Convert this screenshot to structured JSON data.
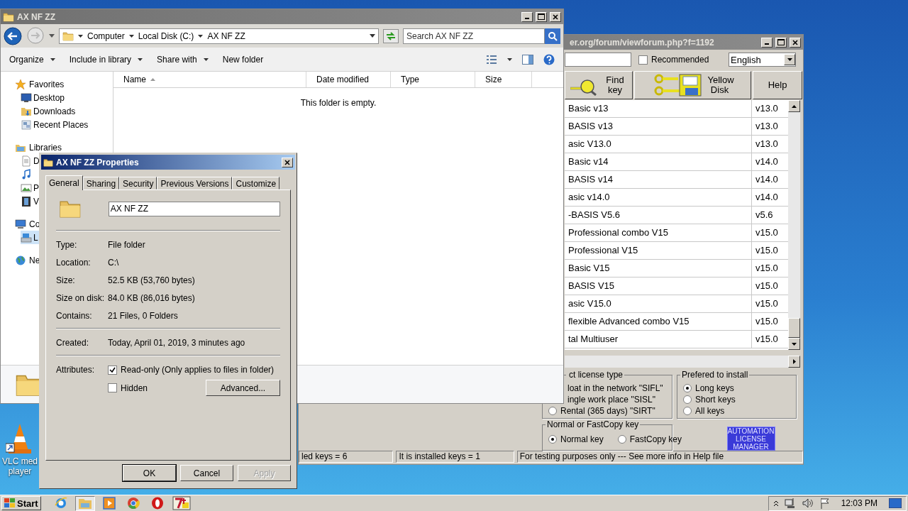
{
  "desktop": {
    "icons": [
      {
        "kind": "cone",
        "lines": [
          "VLC med",
          "player"
        ]
      }
    ]
  },
  "license_window": {
    "title": "er.org/forum/viewforum.php?f=1192",
    "recommended": {
      "label": "Recommended",
      "checked": false
    },
    "language": "English",
    "toolbar": [
      {
        "kind": "find",
        "label": "Find key"
      },
      {
        "kind": "disk",
        "label": "Yellow Disk"
      },
      {
        "kind": "text",
        "label": "Help"
      }
    ],
    "rows": [
      {
        "name": "Basic v13",
        "version": "v13.0"
      },
      {
        "name": "BASIS v13",
        "version": "v13.0"
      },
      {
        "name": "asic V13.0",
        "version": "v13.0"
      },
      {
        "name": "Basic v14",
        "version": "v14.0"
      },
      {
        "name": "BASIS v14",
        "version": "v14.0"
      },
      {
        "name": "asic v14.0",
        "version": "v14.0"
      },
      {
        "name": "-BASIS V5.6",
        "version": "v5.6"
      },
      {
        "name": "Professional combo V15",
        "version": "v15.0"
      },
      {
        "name": "Professional V15",
        "version": "v15.0"
      },
      {
        "name": "Basic V15",
        "version": "v15.0"
      },
      {
        "name": "BASIS V15",
        "version": "v15.0"
      },
      {
        "name": "asic V15.0",
        "version": "v15.0"
      },
      {
        "name": "flexible Advanced combo V15",
        "version": "v15.0"
      },
      {
        "name": "tal Multiuser",
        "version": "v15.0"
      }
    ],
    "license_type": {
      "title": "ct license type",
      "cut_options": [
        "loat in the network \"SIFL\"",
        "ingle work place \"SISL\""
      ],
      "rental": {
        "label": "Rental (365 days) \"SIRT\"",
        "selected": false
      }
    },
    "install": {
      "title": "Prefered to install",
      "options": [
        {
          "label": "Long keys",
          "selected": true
        },
        {
          "label": "Short keys",
          "selected": false
        },
        {
          "label": "All keys",
          "selected": false
        }
      ]
    },
    "key_type": {
      "title": "Normal or FastCopy key",
      "options": [
        {
          "label": "Normal key",
          "selected": true
        },
        {
          "label": "FastCopy key",
          "selected": false
        }
      ]
    },
    "manager_button": "AUTOMATION LICENSE MANAGER",
    "status_bar": [
      "led keys = 6",
      "It is installed keys = 1",
      "For testing purposes only --- See more info in Help file"
    ]
  },
  "explorer": {
    "title": "AX NF ZZ",
    "breadcrumbs": [
      "Computer",
      "Local Disk (C:)",
      "AX NF ZZ"
    ],
    "search": {
      "placeholder": "Search AX NF ZZ"
    },
    "toolbar": [
      {
        "label": "Organize",
        "dropdown": true
      },
      {
        "label": "Include in library",
        "dropdown": true
      },
      {
        "label": "Share with",
        "dropdown": true
      },
      {
        "label": "New folder",
        "dropdown": false
      }
    ],
    "nav": [
      {
        "kind": "star",
        "label": "Favorites",
        "selected": false,
        "children": [
          {
            "kind": "desktop",
            "label": "Desktop",
            "selected": false
          },
          {
            "kind": "downloads",
            "label": "Downloads",
            "selected": false
          },
          {
            "kind": "recent",
            "label": "Recent Places",
            "selected": false
          }
        ]
      },
      {
        "kind": "library",
        "label": "Libraries",
        "selected": false,
        "children": [
          {
            "kind": "document",
            "label": "D",
            "selected": false
          },
          {
            "kind": "music",
            "selected": false
          },
          {
            "kind": "pictures",
            "label": "P",
            "selected": false
          },
          {
            "kind": "video",
            "label": "V",
            "selected": false
          }
        ]
      },
      {
        "kind": "computer",
        "label": "Co",
        "selected": false,
        "children": [
          {
            "kind": "disk",
            "label": "L",
            "selected": true
          }
        ]
      },
      {
        "kind": "network",
        "label": "Ne",
        "selected": false
      }
    ],
    "columns": [
      {
        "label": "Name",
        "sorted": true
      },
      {
        "label": "Date modified",
        "sorted": false
      },
      {
        "label": "Type",
        "sorted": false
      },
      {
        "label": "Size",
        "sorted": false
      }
    ],
    "empty_message": "This folder is empty."
  },
  "properties": {
    "title": "AX NF ZZ Properties",
    "tabs": [
      {
        "label": "General",
        "selected": true
      },
      {
        "label": "Sharing",
        "selected": false
      },
      {
        "label": "Security",
        "selected": false
      },
      {
        "label": "Previous Versions",
        "selected": false
      },
      {
        "label": "Customize",
        "selected": false
      }
    ],
    "name": "AX NF ZZ",
    "sections": [
      [
        {
          "label": "Type:",
          "value": "File folder"
        },
        {
          "label": "Location:",
          "value": "C:\\"
        },
        {
          "label": "Size:",
          "value": "52.5 KB (53,760 bytes)"
        },
        {
          "label": "Size on disk:",
          "value": "84.0 KB (86,016 bytes)"
        },
        {
          "label": "Contains:",
          "value": "21 Files, 0 Folders"
        }
      ],
      [
        {
          "label": "Created:",
          "value": "Today, April 01, 2019, 3 minutes ago"
        }
      ]
    ],
    "attributes": {
      "label": "Attributes:",
      "checks": [
        {
          "label": "Read-only (Only applies to files in folder)",
          "checked": true
        },
        {
          "label": "Hidden",
          "checked": false
        }
      ],
      "advanced": "Advanced..."
    },
    "buttons": [
      {
        "label": "OK",
        "disabled": false
      },
      {
        "label": "Cancel",
        "disabled": false
      },
      {
        "label": "Apply",
        "disabled": true
      }
    ]
  },
  "taskbar": {
    "start": "Start",
    "apps": [
      {
        "kind": "ie",
        "active": false
      },
      {
        "kind": "explorer",
        "active": true
      },
      {
        "kind": "media",
        "active": false
      },
      {
        "kind": "chrome",
        "active": false
      },
      {
        "kind": "opera",
        "active": false
      },
      {
        "kind": "tool",
        "active": false
      }
    ],
    "clock": "12:03 PM"
  }
}
